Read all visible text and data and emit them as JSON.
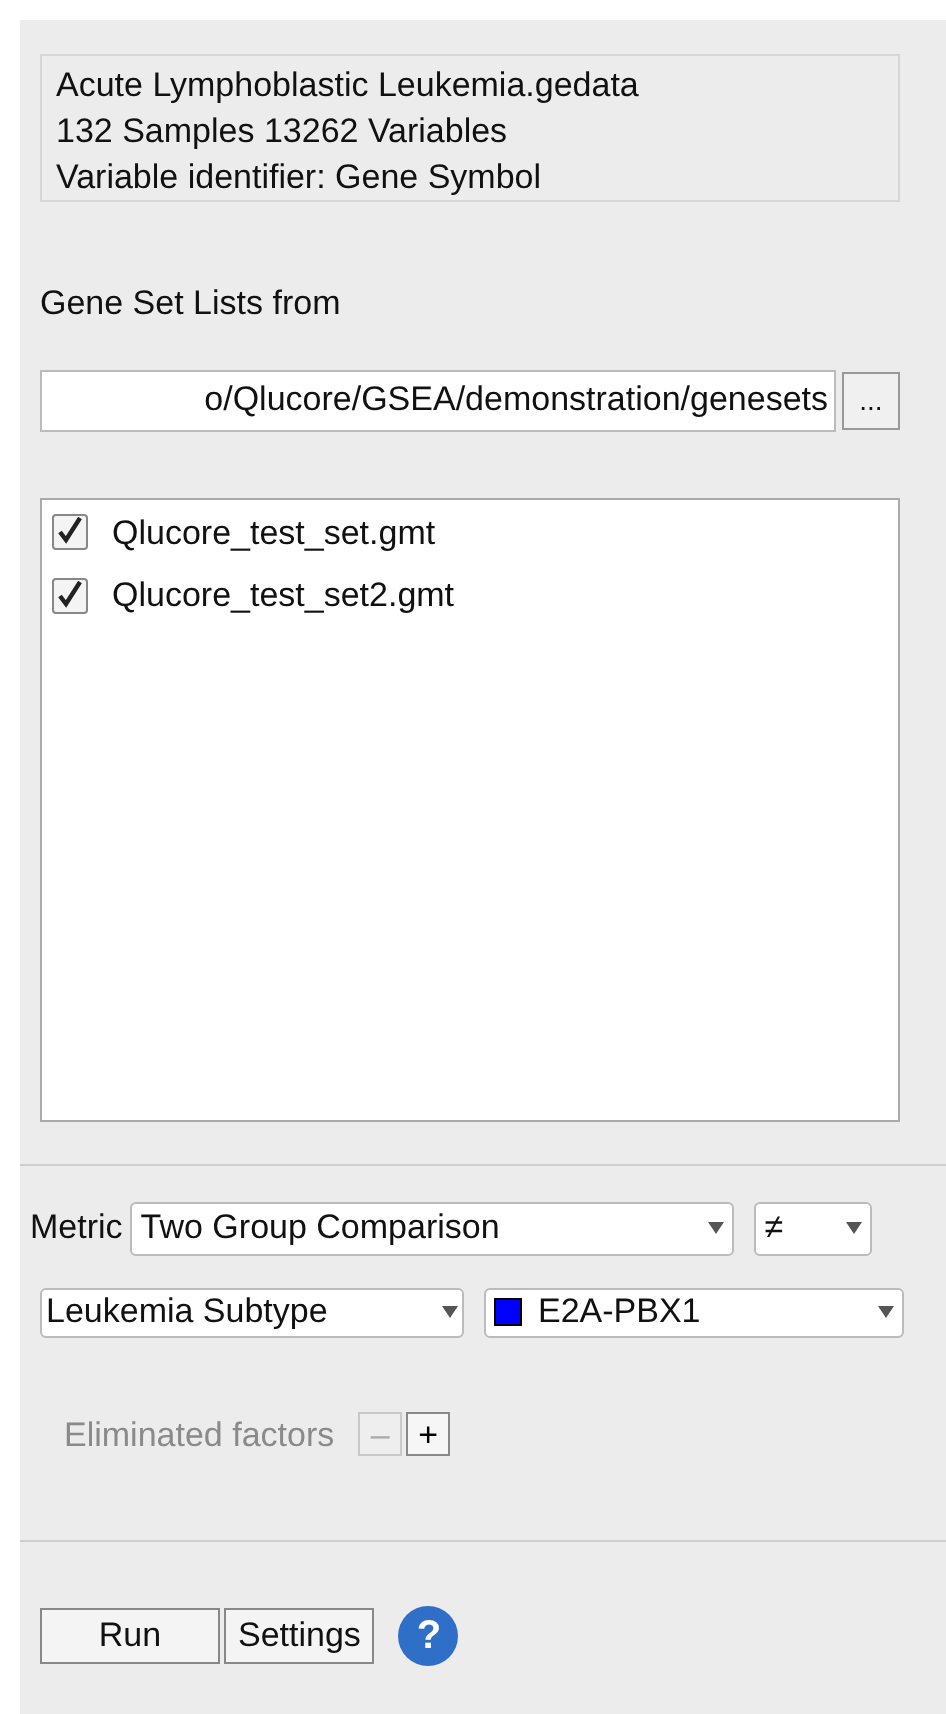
{
  "info": [
    "Acute Lymphoblastic Leukemia.gedata",
    "132 Samples 13262 Variables",
    "Variable identifier: Gene Symbol"
  ],
  "gene_sets_label": "Gene Set Lists from",
  "path_field": {
    "value": "o/Qlucore/GSEA/demonstration/genesets",
    "browse_button": "..."
  },
  "gene_sets": [
    {
      "label": "Qlucore_test_set.gmt",
      "checked": true
    },
    {
      "label": "Qlucore_test_set2.gmt",
      "checked": true
    }
  ],
  "metric": {
    "label": "Metric",
    "value": "Two Group Comparison",
    "operator": "≠"
  },
  "grouping": {
    "variable": "Leukemia Subtype",
    "group": "E2A-PBX1",
    "color": "#0000ff"
  },
  "eliminated_factors": {
    "label": "Eliminated factors",
    "disabled": true,
    "remove": {
      "label": "–",
      "disabled": true
    },
    "add": {
      "label": "+",
      "disabled": false
    }
  },
  "buttons": [
    "Run",
    "Settings"
  ],
  "help_button": "?"
}
